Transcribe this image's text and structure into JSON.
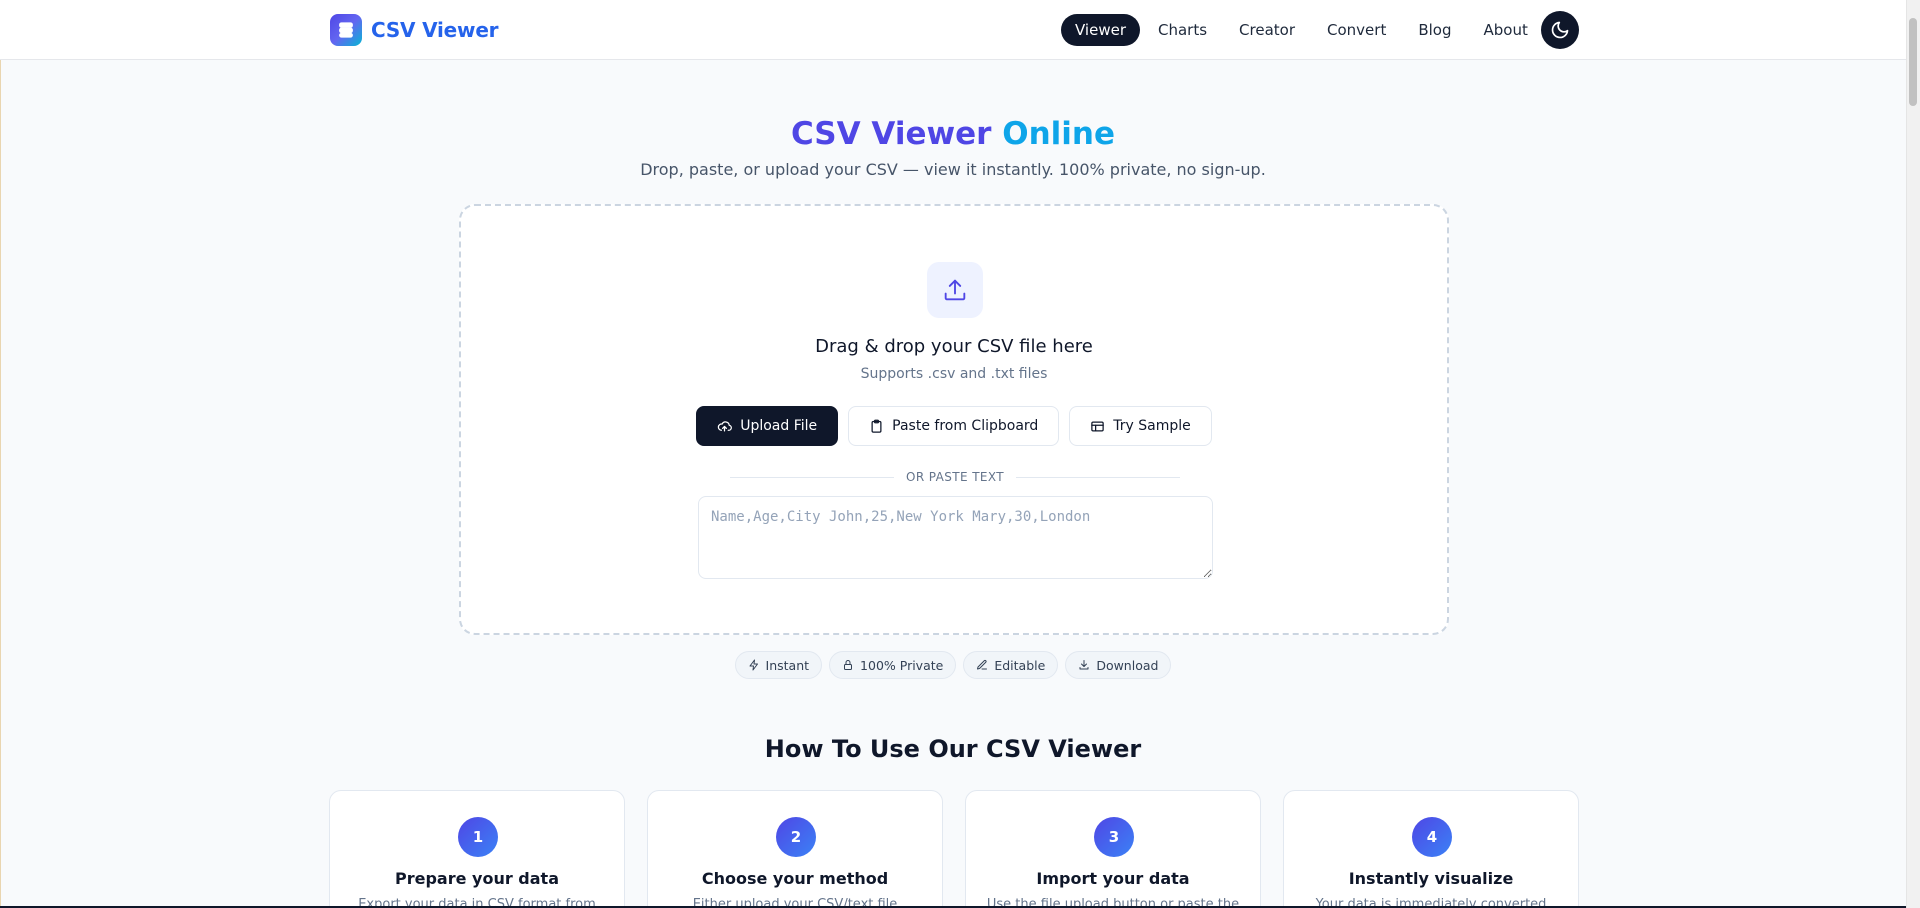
{
  "header": {
    "brand_name": "CSV Viewer",
    "nav": [
      {
        "label": "Viewer",
        "active": true
      },
      {
        "label": "Charts",
        "active": false
      },
      {
        "label": "Creator",
        "active": false
      },
      {
        "label": "Convert",
        "active": false
      },
      {
        "label": "Blog",
        "active": false
      },
      {
        "label": "About",
        "active": false
      }
    ],
    "theme_icon": "moon-icon"
  },
  "hero": {
    "title_part1": "CSV Viewer",
    "title_part2": "Online",
    "subtitle": "Drop, paste, or upload your CSV — view it instantly. 100% private, no sign-up."
  },
  "dropzone": {
    "title": "Drag & drop your CSV file here",
    "subtitle": "Supports .csv and .txt files",
    "buttons": {
      "upload": "Upload File",
      "paste": "Paste from Clipboard",
      "sample": "Try Sample"
    },
    "divider_text": "OR PASTE TEXT",
    "textarea_placeholder": "Name,Age,City John,25,New York Mary,30,London"
  },
  "features": [
    {
      "label": "Instant",
      "icon": "lightning-icon"
    },
    {
      "label": "100% Private",
      "icon": "lock-icon"
    },
    {
      "label": "Editable",
      "icon": "edit-icon"
    },
    {
      "label": "Download",
      "icon": "download-icon"
    }
  ],
  "howto": {
    "title": "How To Use Our CSV Viewer",
    "steps": [
      {
        "num": "1",
        "title": "Prepare your data",
        "desc": "Export your data in CSV format from"
      },
      {
        "num": "2",
        "title": "Choose your method",
        "desc": "Either upload your CSV/text file"
      },
      {
        "num": "3",
        "title": "Import your data",
        "desc": "Use the file upload button or paste the"
      },
      {
        "num": "4",
        "title": "Instantly visualize",
        "desc": "Your data is immediately converted"
      }
    ]
  },
  "colors": {
    "accent_dark": "#0f172a",
    "brand_blue": "#2563eb",
    "title_indigo": "#4f46e5",
    "title_cyan": "#0ea5e9"
  }
}
